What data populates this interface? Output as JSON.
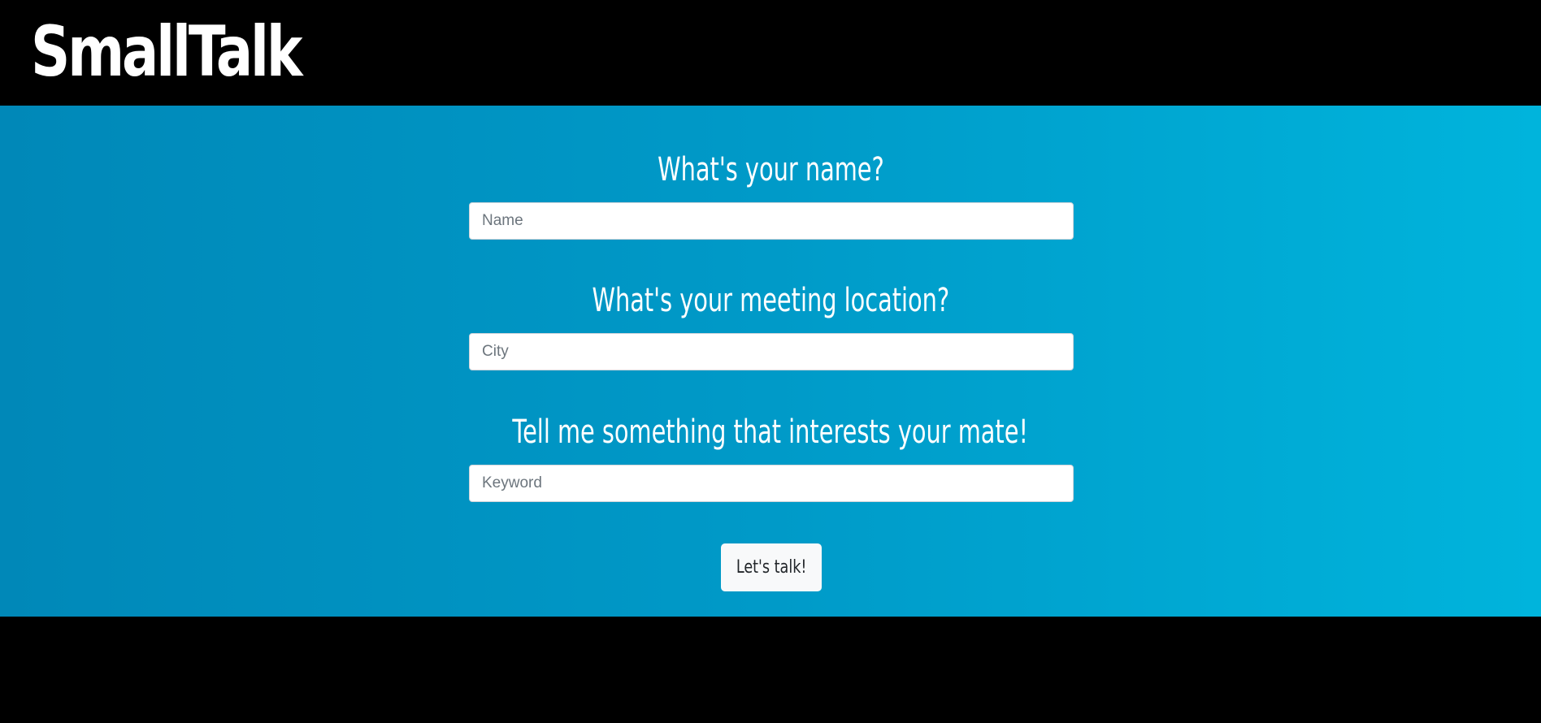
{
  "header": {
    "brand": "SmallTalk"
  },
  "form": {
    "name_question": "What's your name?",
    "name_placeholder": "Name",
    "name_value": "",
    "location_question": "What's your meeting location?",
    "location_placeholder": "City",
    "location_value": "",
    "interest_question": "Tell me something that interests your mate!",
    "interest_placeholder": "Keyword",
    "interest_value": "",
    "submit_label": "Let's talk!"
  },
  "colors": {
    "header_background": "#000000",
    "hero_gradient_start": "#0088b8",
    "hero_gradient_end": "#00b4dc",
    "text_color": "#ffffff",
    "button_background": "#f8f9fa"
  }
}
